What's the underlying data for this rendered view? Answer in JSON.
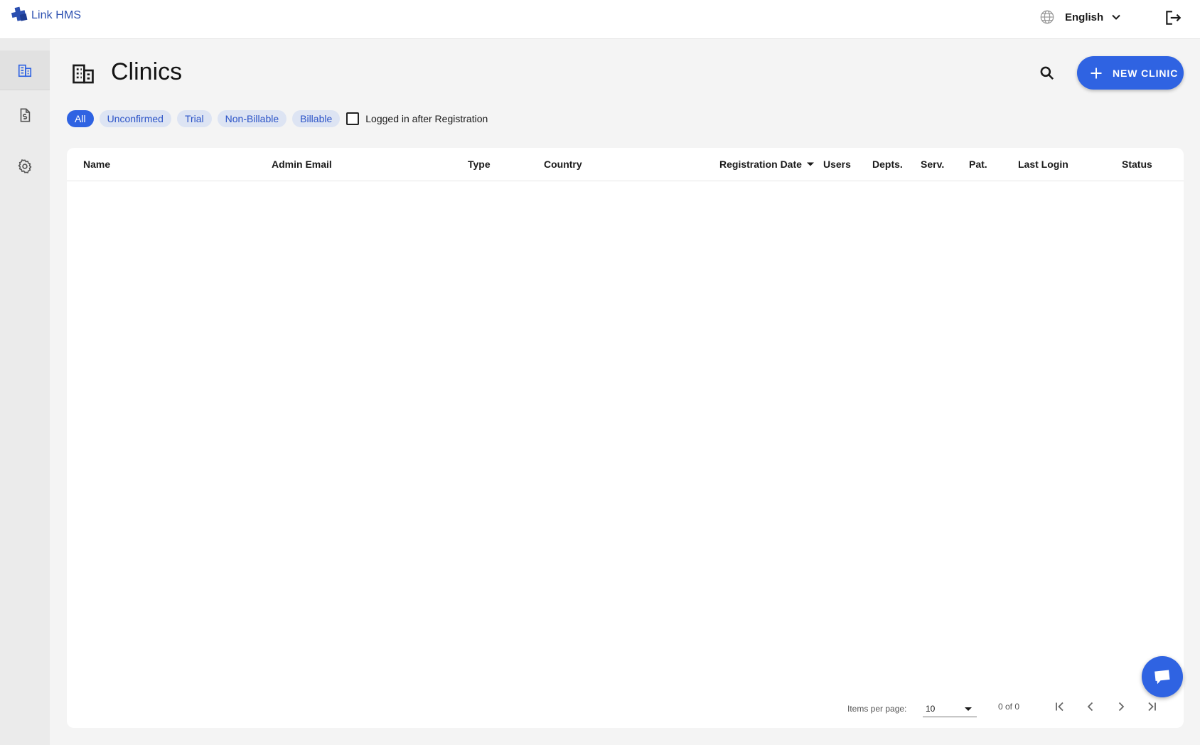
{
  "app": {
    "brand": "Link HMS"
  },
  "topbar": {
    "language": "English",
    "globe_icon": "globe-icon",
    "logout_icon": "logout-icon"
  },
  "sidebar": {
    "items": [
      {
        "icon": "clinics-icon",
        "active": true
      },
      {
        "icon": "invoice-icon",
        "active": false
      },
      {
        "icon": "settings-icon",
        "active": false
      }
    ]
  },
  "page": {
    "title": "Clinics",
    "new_button": "NEW CLINIC",
    "accent": "#2f63e2"
  },
  "filters": {
    "chips": [
      "All",
      "Unconfirmed",
      "Trial",
      "Non-Billable",
      "Billable"
    ],
    "active": "All",
    "checkbox_label": "Logged in after Registration",
    "checkbox_checked": false
  },
  "table": {
    "columns": [
      "Name",
      "Admin Email",
      "Type",
      "Country",
      "Registration Date",
      "Users",
      "Depts.",
      "Serv.",
      "Pat.",
      "Last Login",
      "Status"
    ],
    "sorted_column": "Registration Date",
    "sort_direction": "desc",
    "rows": []
  },
  "paginator": {
    "items_per_page_label": "Items per page:",
    "items_per_page": "10",
    "range": "0 of 0"
  }
}
